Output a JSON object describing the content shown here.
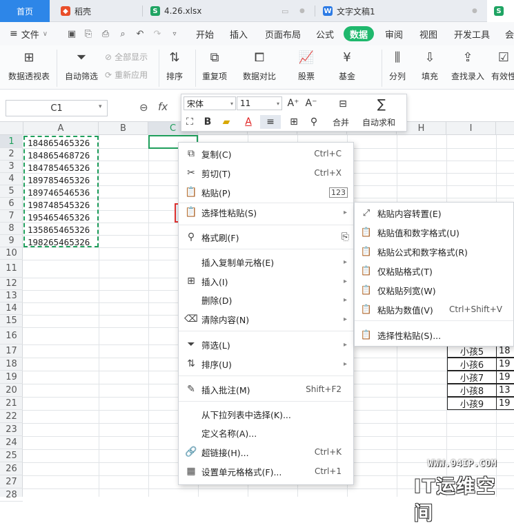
{
  "tabs": {
    "home": "首页",
    "docer": "稻壳",
    "xlsx": "4.26.xlsx",
    "doc": "文字文稿1"
  },
  "menu": {
    "file": "文件",
    "items": [
      "开始",
      "插入",
      "页面布局",
      "公式",
      "数据",
      "审阅",
      "视图",
      "开发工具",
      "会"
    ],
    "active_index": 4
  },
  "ribbon": {
    "pivot": "数据透视表",
    "autofilter": "自动筛选",
    "show_all": "全部显示",
    "reapply": "重新应用",
    "sort": "排序",
    "duplicates": "重复项",
    "compare": "数据对比",
    "stock": "股票",
    "fund": "基金",
    "split": "分列",
    "fill": "填充",
    "lookup": "查找录入",
    "validity": "有效性"
  },
  "formula_bar": {
    "name_box": "C1",
    "fx": "fx"
  },
  "mini_toolbar": {
    "font": "宋体",
    "size": "11",
    "merge": "合并",
    "autosum": "自动求和"
  },
  "columns": [
    "A",
    "B",
    "C",
    "D",
    "E",
    "F",
    "G",
    "H",
    "I"
  ],
  "rows": [
    "1",
    "2",
    "3",
    "4",
    "5",
    "6",
    "7",
    "8",
    "9",
    "10",
    "11",
    "12",
    "13",
    "14",
    "15",
    "16",
    "17",
    "18",
    "19",
    "20",
    "21",
    "22",
    "23",
    "24",
    "25",
    "26",
    "27",
    "28"
  ],
  "cells_A": [
    "184865465326",
    "184865468726",
    "184785465326",
    "189785465326",
    "189746546536",
    "198748545326",
    "195465465326",
    "135865465326",
    "198265465326"
  ],
  "side_table": {
    "names": [
      "小孩5",
      "小孩6",
      "小孩7",
      "小孩8",
      "小孩9"
    ],
    "values": [
      "18",
      "19",
      "19",
      "13",
      "19"
    ]
  },
  "context_menu": [
    {
      "label": "复制(C)",
      "key": "Ctrl+C",
      "icon": "copy-icon"
    },
    {
      "label": "剪切(T)",
      "key": "Ctrl+X",
      "icon": "scissors-icon"
    },
    {
      "label": "粘贴(P)",
      "key": "",
      "icon": "paste-icon"
    },
    {
      "label": "选择性粘贴(S)",
      "key": "",
      "icon": "paste-special-icon"
    },
    {
      "label": "格式刷(F)",
      "key": "",
      "icon": "format-painter-icon"
    },
    {
      "label": "插入复制单元格(E)",
      "key": "",
      "icon": ""
    },
    {
      "label": "插入(I)",
      "key": "",
      "icon": "insert-icon"
    },
    {
      "label": "删除(D)",
      "key": "",
      "icon": ""
    },
    {
      "label": "清除内容(N)",
      "key": "",
      "icon": "eraser-icon"
    },
    {
      "label": "筛选(L)",
      "key": "",
      "icon": "filter-icon"
    },
    {
      "label": "排序(U)",
      "key": "",
      "icon": "sort-icon"
    },
    {
      "label": "插入批注(M)",
      "key": "Shift+F2",
      "icon": "comment-icon"
    },
    {
      "label": "从下拉列表中选择(K)...",
      "key": "",
      "icon": ""
    },
    {
      "label": "定义名称(A)...",
      "key": "",
      "icon": ""
    },
    {
      "label": "超链接(H)...",
      "key": "Ctrl+K",
      "icon": "link-icon"
    },
    {
      "label": "设置单元格格式(F)...",
      "key": "Ctrl+1",
      "icon": "cell-format-icon"
    }
  ],
  "submenu": [
    {
      "label": "粘贴内容转置(E)",
      "key": ""
    },
    {
      "label": "粘贴值和数字格式(U)",
      "key": ""
    },
    {
      "label": "粘贴公式和数字格式(R)",
      "key": ""
    },
    {
      "label": "仅粘贴格式(T)",
      "key": ""
    },
    {
      "label": "仅粘贴列宽(W)",
      "key": ""
    },
    {
      "label": "粘贴为数值(V)",
      "key": "Ctrl+Shift+V"
    },
    {
      "label": "选择性粘贴(S)...",
      "key": ""
    }
  ],
  "watermark": {
    "url": "WWW.94IP.COM",
    "brand": "IT运维空间"
  }
}
